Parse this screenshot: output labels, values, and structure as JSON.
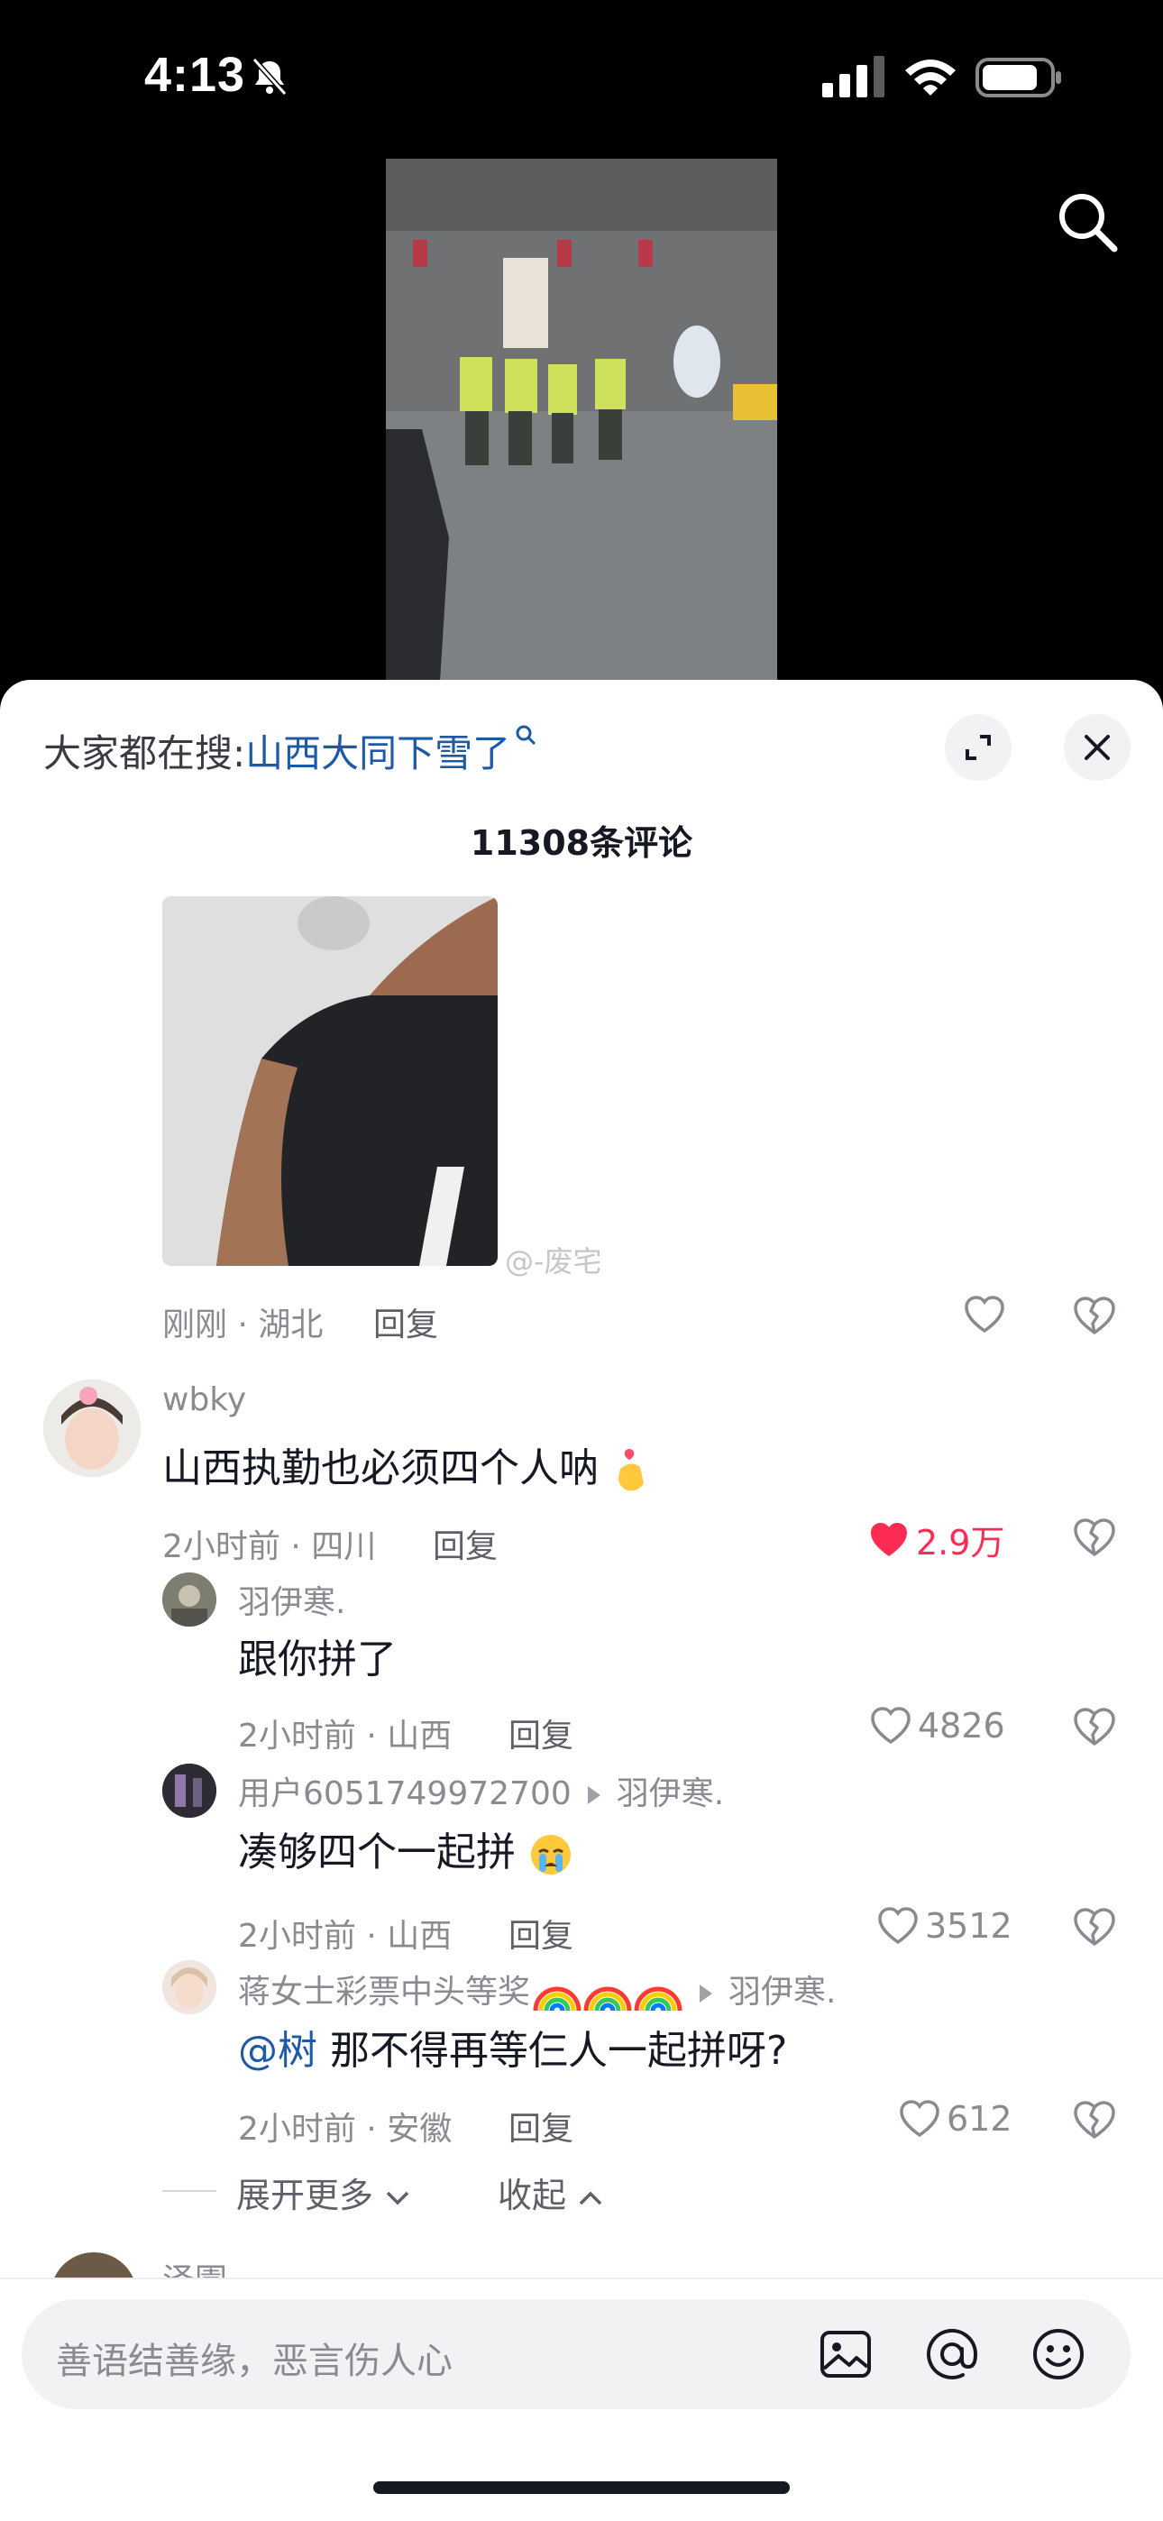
{
  "status_bar": {
    "time": "4:13"
  },
  "sheet": {
    "hot_search_prefix": "大家都在搜:",
    "hot_search_keyword": "山西大同下雪了",
    "comment_count": "11308条评论"
  },
  "first_comment": {
    "watermark": "@-废宅",
    "meta": "刚刚 · 湖北",
    "reply": "回复"
  },
  "comments": [
    {
      "username": "wbky",
      "text": "山西执勤也必须四个人呐",
      "meta": "2小时前 · 四川",
      "reply": "回复",
      "likes": "2.9万",
      "liked": true
    }
  ],
  "replies": [
    {
      "username": "羽伊寒.",
      "reply_to": "",
      "text": "跟你拼了",
      "meta": "2小时前 · 山西",
      "reply": "回复",
      "likes": "4826"
    },
    {
      "username": "用户6051749972700",
      "reply_to": "羽伊寒.",
      "text": "凑够四个一起拼",
      "meta": "2小时前 · 山西",
      "reply": "回复",
      "likes": "3512"
    },
    {
      "username": "蒋女士彩票中头等奖",
      "reply_to": "羽伊寒.",
      "mention": "@树",
      "text": "那不得再等仨人一起拼呀?",
      "meta": "2小时前 · 安徽",
      "reply": "回复",
      "likes": "612"
    }
  ],
  "thread_controls": {
    "expand_more": "展开更多",
    "collapse": "收起"
  },
  "next_comment_peek": {
    "username": "泽園"
  },
  "input": {
    "placeholder": "善语结善缘，恶言伤人心"
  },
  "colors": {
    "accent": "#fe2c55",
    "link": "#1c5aa8",
    "text": "#161823",
    "muted": "#8a8b91"
  }
}
